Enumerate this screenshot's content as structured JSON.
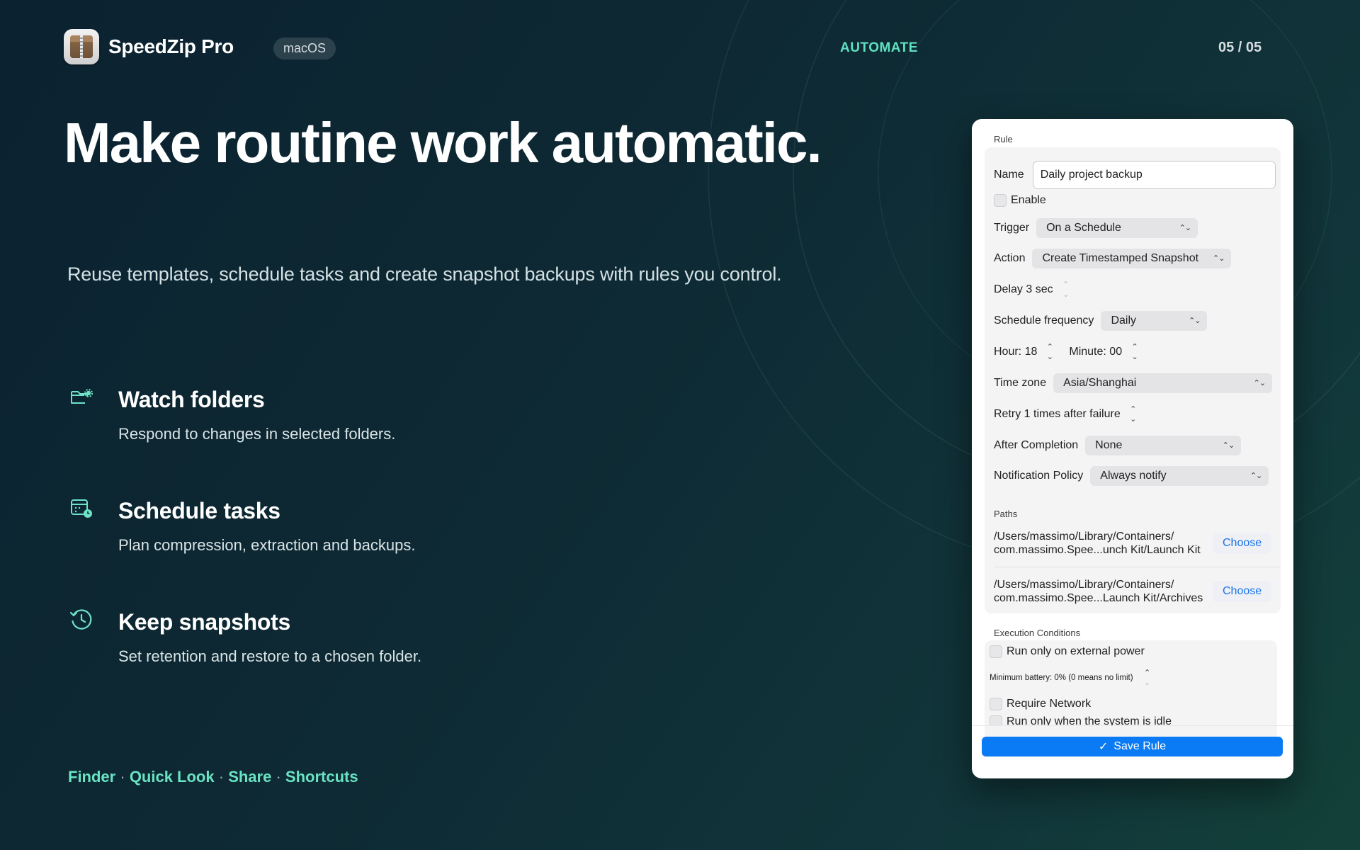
{
  "header": {
    "app_name": "SpeedZip Pro",
    "platform": "macOS",
    "section": "AUTOMATE",
    "page_counter": "05 / 05"
  },
  "hero": {
    "headline": "Make routine work automatic.",
    "subhead": "Reuse templates, schedule tasks and create snapshot backups with rules you control."
  },
  "features": [
    {
      "icon": "folder-gear-icon",
      "title": "Watch folders",
      "desc": "Respond to changes in selected folders."
    },
    {
      "icon": "calendar-clock-icon",
      "title": "Schedule tasks",
      "desc": "Plan compression, extraction and backups."
    },
    {
      "icon": "history-icon",
      "title": "Keep snapshots",
      "desc": "Set retention and restore to a chosen folder."
    }
  ],
  "integrations": [
    "Finder",
    "Quick Look",
    "Share",
    "Shortcuts"
  ],
  "integrations_separator": "·",
  "panel": {
    "rule_section": "Rule",
    "name_label": "Name",
    "name_value": "Daily project backup",
    "enable_label": "Enable",
    "enable_checked": false,
    "trigger_label": "Trigger",
    "trigger_value": "On a Schedule",
    "action_label": "Action",
    "action_value": "Create Timestamped Snapshot",
    "delay_label": "Delay 3 sec",
    "schedule_frequency_label": "Schedule frequency",
    "schedule_frequency_value": "Daily",
    "hour_label": "Hour: 18",
    "minute_label": "Minute: 00",
    "time_zone_label": "Time zone",
    "time_zone_value": "Asia/Shanghai",
    "retry_label": "Retry 1 times after failure",
    "after_completion_label": "After Completion",
    "after_completion_value": "None",
    "notification_label": "Notification Policy",
    "notification_value": "Always notify",
    "paths_section": "Paths",
    "paths": [
      {
        "line1": "/Users/massimo/Library/Containers/",
        "line2": "com.massimo.Spee...unch Kit/Launch Kit",
        "button": "Choose"
      },
      {
        "line1": "/Users/massimo/Library/Containers/",
        "line2": "com.massimo.Spee...Launch Kit/Archives",
        "button": "Choose"
      }
    ],
    "conditions_section": "Execution Conditions",
    "external_power_label": "Run only on external power",
    "min_battery_label": "Minimum battery: 0% (0 means no limit)",
    "require_network_label": "Require Network",
    "idle_label": "Run only when the system is idle",
    "save_button": "Save Rule"
  },
  "colors": {
    "accent": "#5fe0c0",
    "primary_button": "#0a7bf5",
    "link": "#1a73e8"
  }
}
